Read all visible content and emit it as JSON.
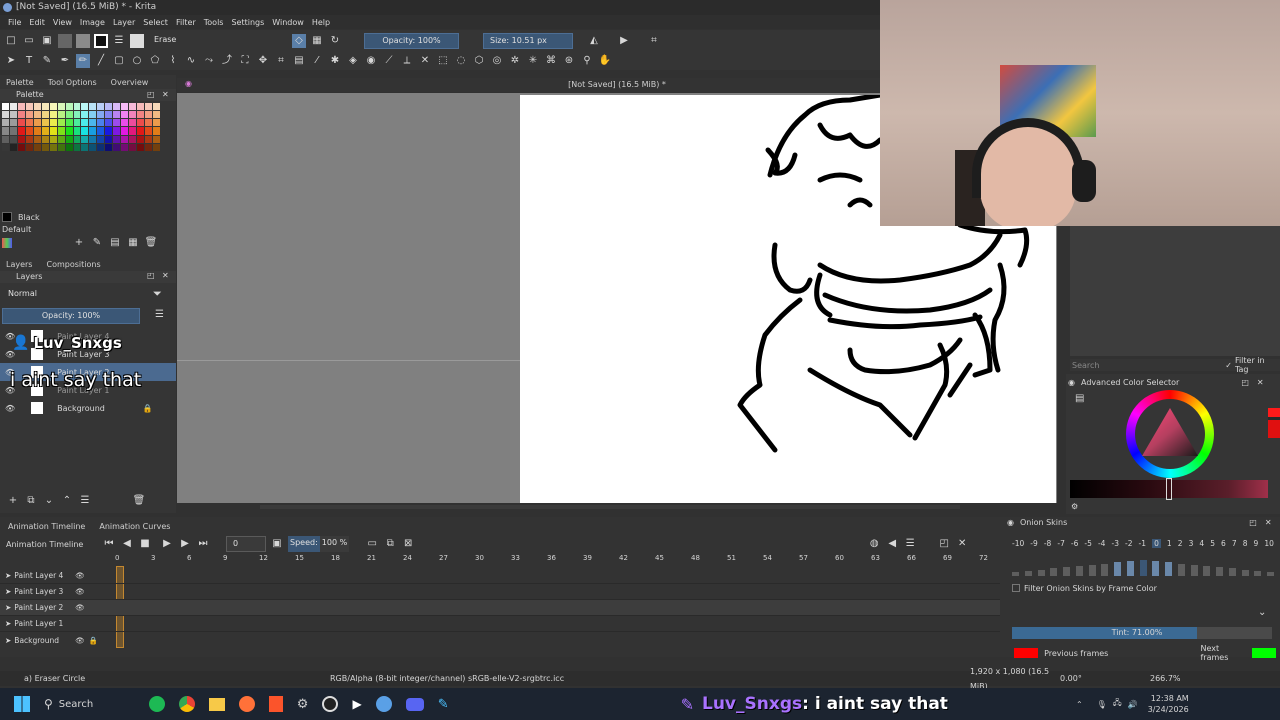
{
  "window": {
    "title": "[Not Saved] (16.5 MiB) * - Krita"
  },
  "menu": [
    "File",
    "Edit",
    "View",
    "Image",
    "Layer",
    "Select",
    "Filter",
    "Tools",
    "Settings",
    "Window",
    "Help"
  ],
  "toolbar": {
    "preset": "Erase",
    "opacity": "Opacity: 100%",
    "size": "Size: 10.51 px"
  },
  "left_panel": {
    "tabs": [
      "Palette",
      "Tool Options",
      "Overview"
    ],
    "palette_title": "Palette",
    "current_color": "Black",
    "palette_name": "Default",
    "layers_tabs": [
      "Layers",
      "Compositions"
    ],
    "blend_mode": "Normal",
    "layer_opacity": "Opacity: 100%",
    "layers": [
      "Paint Layer 4",
      "Paint Layer 3",
      "Paint Layer 2",
      "Paint Layer 1",
      "Background"
    ]
  },
  "canvas": {
    "title": "[Not Saved]  (16.5 MiB) *"
  },
  "overlay": {
    "username": "Luv_Snxgs",
    "message": "i aint say that"
  },
  "right_panel": {
    "search_placeholder": "Search",
    "filter_in_tag": "Filter in Tag",
    "color_selector_title": "Advanced Color Selector"
  },
  "timeline": {
    "tabs": [
      "Animation Timeline",
      "Animation Curves"
    ],
    "title": "Animation Timeline",
    "frame": "0",
    "speed_label": "Speed:",
    "speed_value": "100 %",
    "frame_numbers": [
      "0",
      "3",
      "6",
      "9",
      "12",
      "15",
      "18",
      "21",
      "24",
      "27",
      "30",
      "33",
      "36",
      "39",
      "42",
      "45",
      "48",
      "51",
      "54",
      "57",
      "60",
      "63",
      "66",
      "69",
      "72"
    ],
    "layers": [
      "Paint Layer 4",
      "Paint Layer 3",
      "Paint Layer 2",
      "Paint Layer 1",
      "Background"
    ]
  },
  "onion": {
    "title": "Onion Skins",
    "numbers": [
      "-10",
      "-9",
      "-8",
      "-7",
      "-6",
      "-5",
      "-4",
      "-3",
      "-2",
      "-1",
      "0",
      "1",
      "2",
      "3",
      "4",
      "5",
      "6",
      "7",
      "8",
      "9",
      "10"
    ],
    "filter_label": "Filter Onion Skins by Frame Color",
    "tint": "Tint: 71.00%",
    "tint_fraction": 0.71,
    "previous_frames": "Previous frames",
    "next_frames": "Next frames",
    "prev_color": "#ff0000",
    "next_color": "#00ff00"
  },
  "status": {
    "tool": "a) Eraser Circle",
    "color_space": "RGB/Alpha (8-bit integer/channel)  sRGB-elle-V2-srgbtrc.icc",
    "dimensions": "1,920 x 1,080 (16.5 MiB)",
    "rotation": "0.00°",
    "zoom": "266.7%"
  },
  "taskbar": {
    "search": "Search",
    "time": "12:38 AM",
    "date": "3/24/2026"
  },
  "chat": {
    "username": "Luv_Snxgs",
    "message": " : i aint say that"
  }
}
